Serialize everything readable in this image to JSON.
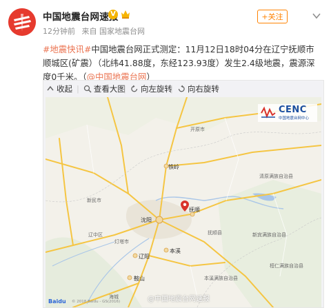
{
  "header": {
    "user_name": "中国地震台网速报",
    "verified_badge": "V",
    "time": "12分钟前",
    "source": "来自 国家地震台网",
    "follow_label": "+关注"
  },
  "post": {
    "tag": "#地震快讯#",
    "text_main": "中国地震台网正式测定：11月12日18时04分在辽宁抚顺市顺城区(矿震）（北纬41.88度，东经123.93度）发生2.4级地震，震源深度0千米。（",
    "mention": "@中国地震台网",
    "text_end": "）"
  },
  "toolbar": {
    "collapse_label": "收起",
    "view_large_label": "查看大图",
    "rotate_left_label": "向左旋转",
    "rotate_right_label": "向右旋转"
  },
  "map": {
    "logo_text": "CENC",
    "logo_subtext": "中国地震台网中心",
    "watermark": "@中国地震台网速报",
    "baidu_label": "Baidu",
    "copyright": "© 2018 Baidu - GS(2016)",
    "labels": {
      "tieling": "铁岭",
      "shenyang": "沈阳",
      "fushun": "抚顺",
      "benxi": "本溪",
      "liaoyang": "辽阳",
      "anshan": "鞍山",
      "fuxin_road": "新民市",
      "kaiyuan": "开原市",
      "xinbin": "新宾满族自治县",
      "qingyuan": "清原满族自治县",
      "benxi_county": "本溪满族自治县",
      "huanren": "桓仁满族自治县",
      "haicheng": "海城",
      "dengta": "灯塔市",
      "liaozhong": "辽中区",
      "fushun_county": "抚顺县"
    },
    "epicenter_color": "#d9332b",
    "road_color": "#f5c542"
  }
}
